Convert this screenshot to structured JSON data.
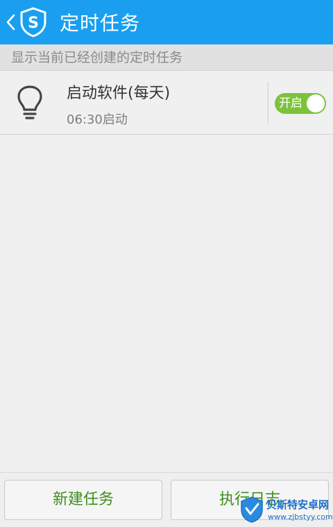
{
  "header": {
    "title": "定时任务",
    "back_icon": "chevron-left-icon",
    "logo_icon": "shield-s-icon",
    "logo_letter": "S",
    "background_color": "#1a9ff0"
  },
  "section_hint": "显示当前已经创建的定时任务",
  "tasks": [
    {
      "name": "启动软件(每天)",
      "time": "06:30启动",
      "icon": "lightbulb-icon",
      "toggle_label": "开启",
      "enabled": true,
      "toggle_color": "#7dc23c"
    }
  ],
  "bottom_bar": {
    "new_task_label": "新建任务",
    "log_label": "执行日志"
  },
  "watermark": {
    "title": "贝斯特安卓网",
    "url": "www.zjbstyy.com"
  },
  "colors": {
    "accent": "#1a9ff0",
    "button_text": "#3e8f1d",
    "toggle_on": "#7dc23c"
  }
}
